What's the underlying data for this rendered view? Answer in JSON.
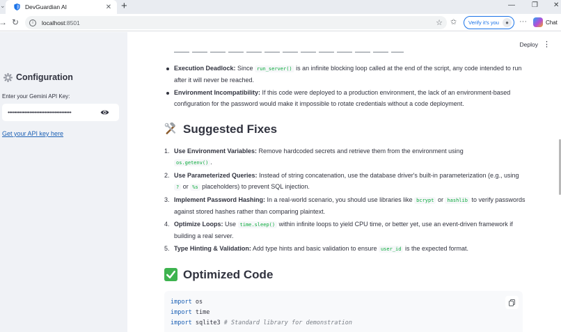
{
  "browser": {
    "tab_title": "DevGuardian AI",
    "tab_close": "✕",
    "new_tab": "+",
    "url_host": "localhost",
    "url_port": ":8501",
    "verify_label": "Verify it's you",
    "chat_label": "Chat",
    "more": "···"
  },
  "sidebar": {
    "title": "Configuration",
    "api_key_label": "Enter your Gemini API Key:",
    "api_key_value": "••••••••••••••••••••••••••••••••••••••",
    "link_text": "Get your API key here"
  },
  "header": {
    "deploy_label": "Deploy",
    "menu": "⋮"
  },
  "issues": [
    {
      "title": "Execution Deadlock:",
      "pre": " Since ",
      "code": "run_server()",
      "post": " is an infinite blocking loop called at the end of the script, any code intended to run after it will never be reached."
    },
    {
      "title": "Environment Incompatibility:",
      "text": " If this code were deployed to a production environment, the lack of an environment-based configuration for the password would make it impossible to rotate credentials without a code deployment."
    }
  ],
  "fixes_heading": "Suggested Fixes",
  "fixes": [
    {
      "num": "1.",
      "title": "Use Environment Variables:",
      "pre": " Remove hardcoded secrets and retrieve them from the environment using ",
      "code": "os.getenv()",
      "post": "."
    },
    {
      "num": "2.",
      "title": "Use Parameterized Queries:",
      "pre": " Instead of string concatenation, use the database driver's built-in parameterization (e.g., using ",
      "code": "?",
      "mid": " or ",
      "code2": "%s",
      "post": " placeholders) to prevent SQL injection."
    },
    {
      "num": "3.",
      "title": "Implement Password Hashing:",
      "pre": " In a real-world scenario, you should use libraries like ",
      "code": "bcrypt",
      "mid": " or ",
      "code2": "hashlib",
      "post": " to verify passwords against stored hashes rather than comparing plaintext."
    },
    {
      "num": "4.",
      "title": "Optimize Loops:",
      "pre": " Use ",
      "code": "time.sleep()",
      "post": " within infinite loops to yield CPU time, or better yet, use an event-driven framework if building a real server."
    },
    {
      "num": "5.",
      "title": "Type Hinting & Validation:",
      "pre": " Add type hints and basic validation to ensure ",
      "code": "user_id",
      "post": " is the expected format."
    }
  ],
  "optimized_heading": "Optimized Code",
  "code_lines": [
    {
      "kw": "import",
      "rest": " os",
      "comment": ""
    },
    {
      "kw": "import",
      "rest": " time",
      "comment": ""
    },
    {
      "kw": "import",
      "rest": " sqlite3 ",
      "comment": "# Standard library for demonstration"
    }
  ],
  "colors": {
    "sidebar_bg": "#f0f2f6",
    "inline_code": "#09ab3b",
    "link": "#1a5fb4",
    "keyword": "#1a5fb4"
  }
}
